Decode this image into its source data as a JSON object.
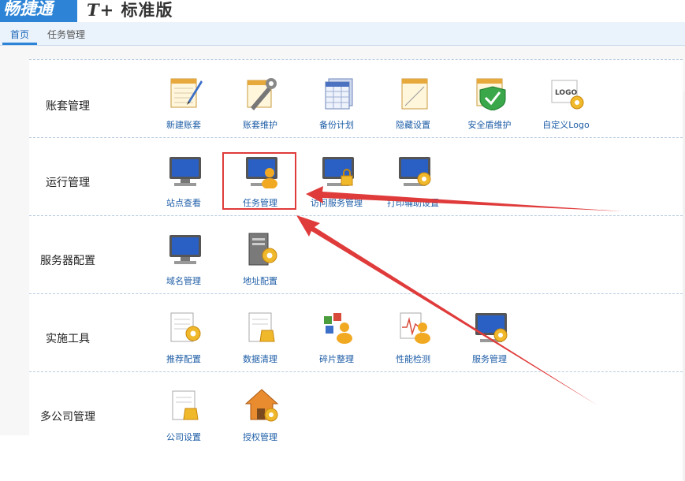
{
  "header": {
    "logo_text": "畅捷通",
    "product_name_prefix": "T+",
    "product_name_suffix": "标准版"
  },
  "tabs": [
    {
      "label": "首页",
      "active": true
    },
    {
      "label": "任务管理",
      "active": false
    }
  ],
  "sections": [
    {
      "label": "账套管理",
      "items": [
        "新建账套",
        "账套维护",
        "备份计划",
        "隐藏设置",
        "安全盾维护",
        "自定义Logo"
      ]
    },
    {
      "label": "运行管理",
      "items": [
        "站点查看",
        "任务管理",
        "访问服务管理",
        "打印辅助设置"
      ]
    },
    {
      "label": "服务器配置",
      "items": [
        "域名管理",
        "地址配置"
      ]
    },
    {
      "label": "实施工具",
      "items": [
        "推荐配置",
        "数据清理",
        "碎片整理",
        "性能检测",
        "服务管理"
      ]
    },
    {
      "label": "多公司管理",
      "items": [
        "公司设置",
        "授权管理"
      ]
    }
  ],
  "colors": {
    "accent": "#2d84d6",
    "highlight": "#e03b3b",
    "link": "#1d5da6"
  }
}
